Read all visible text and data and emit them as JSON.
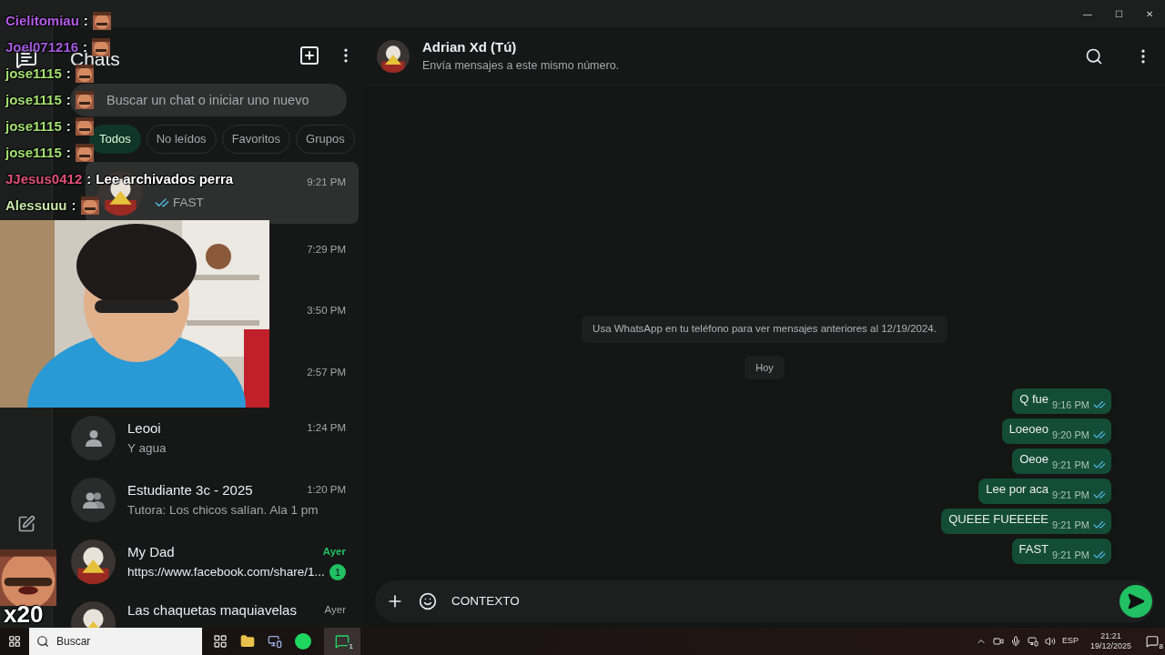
{
  "window": {
    "minimize": "—",
    "maximize": "☐",
    "close": "✕"
  },
  "sidebar": {
    "title": "Chats",
    "search": {
      "placeholder": "Buscar un chat o iniciar uno nuevo"
    },
    "filters": [
      {
        "label": "Todos",
        "selected": true
      },
      {
        "label": "No leídos",
        "selected": false
      },
      {
        "label": "Favoritos",
        "selected": false
      },
      {
        "label": "Grupos",
        "selected": false
      }
    ],
    "chats": [
      {
        "time": "9:21 PM",
        "preview": "FAST",
        "read": true,
        "selected": true
      },
      {
        "kind": "covered",
        "time": "7:29 PM",
        "selected": false
      },
      {
        "kind": "covered",
        "time": "3:50 PM",
        "selected": false
      },
      {
        "kind": "covered",
        "time": "2:57 PM",
        "selected": false
      },
      {
        "kind": "person",
        "name": "Leooi",
        "time": "1:24 PM",
        "preview": "Y agua",
        "selected": false
      },
      {
        "kind": "group",
        "name": "Estudiante 3c - 2025",
        "time": "1:20 PM",
        "preview": "Tutora: Los chicos salían. Ala 1 pm",
        "selected": false
      },
      {
        "name": "My Dad",
        "time": "Ayer",
        "preview": "https://www.facebook.com/share/1...",
        "unread": "1",
        "selected": false
      },
      {
        "name": "Las chaquetas maquiavelas",
        "time": "Ayer",
        "selected": false
      }
    ]
  },
  "conversation": {
    "name": "Adrian Xd (Tú)",
    "subtitle": "Envía mensajes a este mismo número.",
    "notice": "Usa WhatsApp en tu teléfono para ver mensajes anteriores al 12/19/2024.",
    "day": "Hoy",
    "messages": [
      {
        "text": "Q fue",
        "time": "9:16 PM",
        "read": true
      },
      {
        "text": "Loeoeo",
        "time": "9:20 PM",
        "read": true
      },
      {
        "text": "Oeoe",
        "time": "9:21 PM",
        "read": true
      },
      {
        "text": "Lee por aca",
        "time": "9:21 PM",
        "read": true
      },
      {
        "text": "QUEEE FUEEEEE",
        "time": "9:21 PM",
        "read": true
      },
      {
        "text": "FAST",
        "time": "9:21 PM",
        "read": true
      }
    ],
    "composer": {
      "value": "CONTEXTO"
    }
  },
  "stream_chat": [
    {
      "user": "Cielitomiau",
      "separator": ":",
      "color": "#b35ce6",
      "kind": "emote"
    },
    {
      "user": "Joel071216",
      "separator": ":",
      "color": "#a35ade",
      "kind": "emote"
    },
    {
      "user": "jose1115",
      "separator": ":",
      "color": "#a3e070",
      "kind": "emote"
    },
    {
      "user": "jose1115",
      "separator": ":",
      "color": "#a3e070",
      "kind": "emote"
    },
    {
      "user": "jose1115",
      "separator": ":",
      "color": "#a3e070",
      "kind": "emote"
    },
    {
      "user": "jose1115",
      "separator": ":",
      "color": "#a3e070",
      "kind": "emote"
    },
    {
      "user": "JJesus0412",
      "separator": ":",
      "color": "#e0507c",
      "kind": "text",
      "text": "Lee archivados perra"
    },
    {
      "user": "Alessuuu",
      "separator": ":",
      "color": "#c6e8a8",
      "kind": "emote"
    }
  ],
  "emote_combo": {
    "count": "x20"
  },
  "taskbar": {
    "search": "Buscar",
    "whatsapp_badge": "1",
    "language": "ESP",
    "time": "21:21",
    "date": "19/12/2025",
    "notifications": "8"
  }
}
